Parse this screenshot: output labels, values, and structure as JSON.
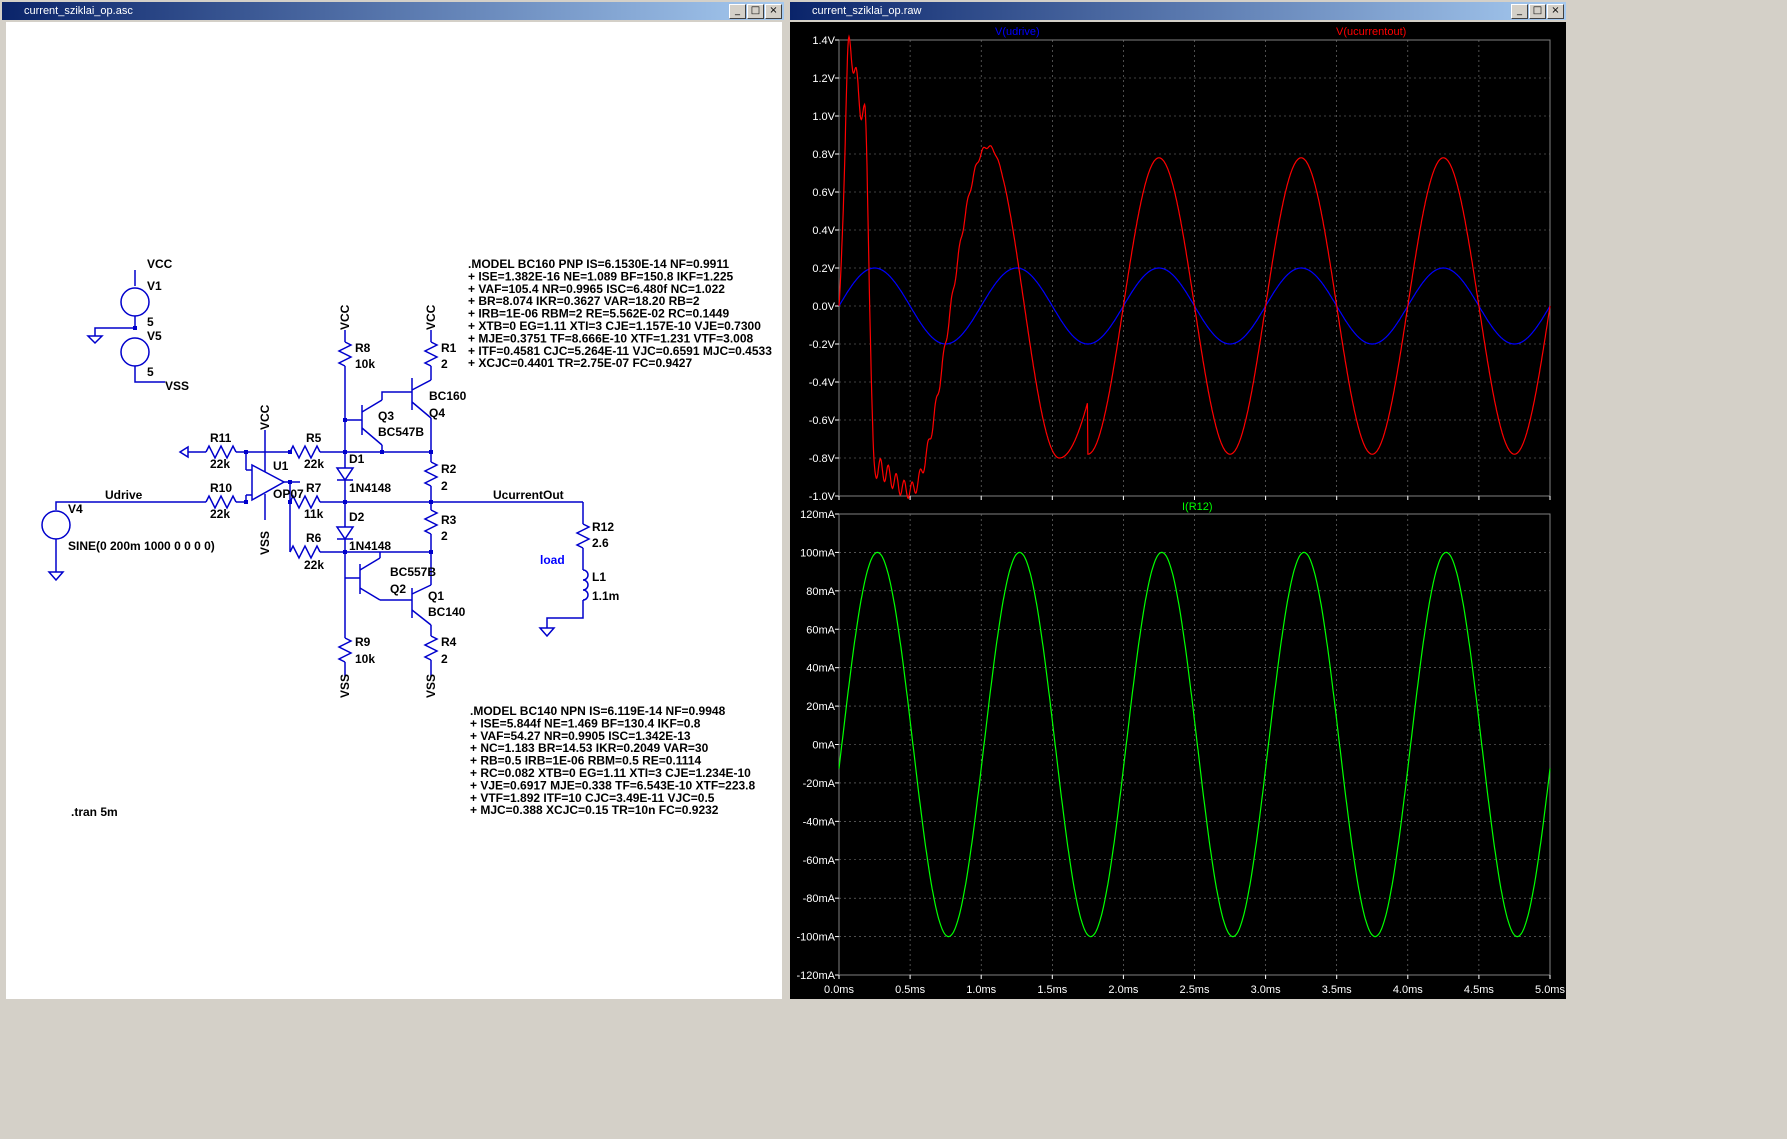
{
  "schematic_window": {
    "title": "current_sziklai_op.asc",
    "buttons": {
      "min": "_",
      "max": "□",
      "close": "×"
    }
  },
  "waveform_window": {
    "title": "current_sziklai_op.raw",
    "buttons": {
      "min": "_",
      "max": "□",
      "close": "×"
    }
  },
  "schematic": {
    "labels": {
      "vcc_top": "VCC",
      "v1": "V1",
      "v1_val": "5",
      "v5": "V5",
      "v5_val": "5",
      "vss_top": "VSS",
      "r8": "R8",
      "r8_val": "10k",
      "r1": "R1",
      "r1_val": "2",
      "vcc_r8": "VCC",
      "vcc_r1": "VCC",
      "bc160": "BC160",
      "q4": "Q4",
      "q3": "Q3",
      "bc547b": "BC547B",
      "r11": "R11",
      "r11_val": "22k",
      "vcc_u1": "VCC",
      "r5": "R5",
      "r5_val": "22k",
      "u1": "U1",
      "d1": "D1",
      "d1_model": "1N4148",
      "r2": "R2",
      "r2_val": "2",
      "udrive": "Udrive",
      "v4": "V4",
      "v4_val": "SINE(0 200m 1000 0 0 0 0)",
      "r10": "R10",
      "r10_val": "22k",
      "op07": "OP07",
      "r7": "R7",
      "r7_val": "11k",
      "ucurrentout": "UcurrentOut",
      "r12": "R12",
      "r12_val": "2.6",
      "d2": "D2",
      "d2_model": "1N4148",
      "r3": "R3",
      "r3_val": "2",
      "vss_u1": "VSS",
      "r6": "R6",
      "r6_val": "22k",
      "bc557b": "BC557B",
      "q2": "Q2",
      "q1": "Q1",
      "bc140": "BC140",
      "load": "load",
      "l1": "L1",
      "l1_val": "1.1m",
      "r9": "R9",
      "r9_val": "10k",
      "r4": "R4",
      "r4_val": "2",
      "vss_r9": "VSS",
      "vss_r4": "VSS",
      "tran": ".tran 5m"
    },
    "model_bc160": [
      ".MODEL BC160 PNP IS=6.1530E-14 NF=0.9911",
      "+ ISE=1.382E-16 NE=1.089 BF=150.8 IKF=1.225",
      "+ VAF=105.4 NR=0.9965 ISC=6.480f NC=1.022",
      "+ BR=8.074 IKR=0.3627 VAR=18.20 RB=2",
      "+ IRB=1E-06 RBM=2 RE=5.562E-02 RC=0.1449",
      "+ XTB=0 EG=1.11 XTI=3 CJE=1.157E-10 VJE=0.7300",
      "+ MJE=0.3751 TF=8.666E-10 XTF=1.231 VTF=3.008",
      "+ ITF=0.4581 CJC=5.264E-11 VJC=0.6591 MJC=0.4533",
      "+ XCJC=0.4401 TR=2.75E-07 FC=0.9427"
    ],
    "model_bc140": [
      ".MODEL BC140 NPN IS=6.119E-14 NF=0.9948",
      "+ ISE=5.844f NE=1.469 BF=130.4 IKF=0.8",
      "+ VAF=54.27 NR=0.9905 ISC=1.342E-13",
      "+ NC=1.183 BR=14.53 IKR=0.2049 VAR=30",
      "+ RB=0.5 IRB=1E-06 RBM=0.5 RE=0.1114",
      "+ RC=0.082 XTB=0 EG=1.11 XTI=3 CJE=1.234E-10",
      "+ VJE=0.6917 MJE=0.338 TF=6.543E-10 XTF=223.8",
      "+ VTF=1.892 ITF=10 CJC=3.49E-11 VJC=0.5",
      "+ MJC=0.388 XCJC=0.15 TR=10n FC=0.9232"
    ]
  },
  "colors": {
    "wire": "#0000cc",
    "udrive": "#0000ff",
    "ucurrentout": "#ff0000",
    "ir12": "#00ff00",
    "grid": "#808080",
    "plot_bg": "#000000",
    "axis_text": "#ffffff"
  },
  "chart_data": [
    {
      "type": "line",
      "x": [
        0,
        0.5,
        1.0,
        1.5,
        2.0,
        2.5,
        3.0,
        3.5,
        4.0,
        4.5,
        5.0
      ],
      "x_unit": "ms",
      "ylim": [
        -1.0,
        1.4
      ],
      "y_ticks": [
        "1.4V",
        "1.2V",
        "1.0V",
        "0.8V",
        "0.6V",
        "0.4V",
        "0.2V",
        "0.0V",
        "-0.2V",
        "-0.4V",
        "-0.6V",
        "-0.8V",
        "-1.0V"
      ],
      "series": [
        {
          "name": "V(udrive)",
          "amplitude": 0.2,
          "frequency_hz": 1000,
          "values_peak_times_ms": [
            0.25,
            1.25,
            2.25,
            3.25,
            4.25
          ]
        },
        {
          "name": "V(ucurrentout)",
          "steady_amplitude": 0.78,
          "peaks": [
            [
              0.07,
              1.35
            ],
            [
              0.18,
              1.0
            ],
            [
              1.05,
              0.84
            ],
            [
              2.25,
              0.78
            ],
            [
              3.25,
              0.77
            ],
            [
              4.25,
              0.77
            ]
          ],
          "troughs": [
            [
              0.25,
              -0.85
            ],
            [
              0.5,
              -0.97
            ],
            [
              1.55,
              -0.8
            ],
            [
              2.75,
              -0.77
            ],
            [
              3.75,
              -0.77
            ],
            [
              4.75,
              -0.77
            ]
          ]
        }
      ]
    },
    {
      "type": "line",
      "x": [
        0,
        0.5,
        1.0,
        1.5,
        2.0,
        2.5,
        3.0,
        3.5,
        4.0,
        4.5,
        5.0
      ],
      "x_unit": "ms",
      "x_ticks": [
        "0.0ms",
        "0.5ms",
        "1.0ms",
        "1.5ms",
        "2.0ms",
        "2.5ms",
        "3.0ms",
        "3.5ms",
        "4.0ms",
        "4.5ms",
        "5.0ms"
      ],
      "ylim": [
        -120,
        120
      ],
      "y_ticks": [
        "120mA",
        "100mA",
        "80mA",
        "60mA",
        "40mA",
        "20mA",
        "0mA",
        "-20mA",
        "-40mA",
        "-60mA",
        "-80mA",
        "-100mA",
        "-120mA"
      ],
      "series": [
        {
          "name": "I(R12)",
          "amplitude_ma": 100,
          "frequency_hz": 1000
        }
      ]
    }
  ]
}
